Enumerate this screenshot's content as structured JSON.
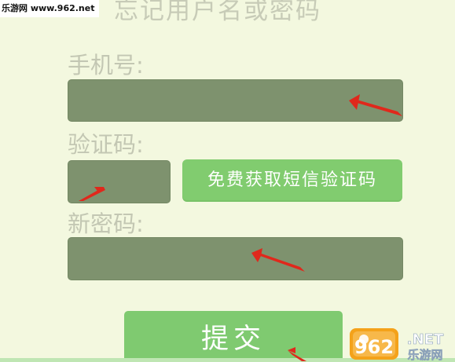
{
  "watermark": {
    "text": "乐游网 www.962.net"
  },
  "header": {
    "title": "忘记用户名或密码"
  },
  "form": {
    "phone_label": "手机号:",
    "phone_value": "",
    "code_label": "验证码:",
    "code_value": "",
    "get_code_button": "免费获取短信验证码",
    "new_password_label": "新密码:",
    "new_password_value": "",
    "submit_button": "提交"
  },
  "logo": {
    "number": "962",
    "suffix": ".NET",
    "site": "乐游网"
  },
  "colors": {
    "background": "#f3f8df",
    "input": "#7e926e",
    "button": "#81cc6f",
    "label": "#c3c7b3",
    "arrow": "#e0281c"
  }
}
